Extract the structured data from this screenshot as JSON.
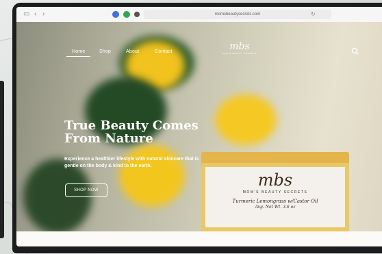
{
  "browser": {
    "url": "momsbeautysecrets.com",
    "icons": [
      "sidebar-icon",
      "back-icon",
      "forward-icon",
      "shield-icon",
      "extension-icon",
      "privacy-icon",
      "reload-icon"
    ]
  },
  "nav": {
    "items": [
      {
        "label": "Home",
        "active": true
      },
      {
        "label": "Shop",
        "active": false
      },
      {
        "label": "About",
        "active": false
      },
      {
        "label": "Contact",
        "active": false
      }
    ],
    "logo": {
      "mark": "mbs",
      "sub": "MOM'S BEAUTY SECRETS"
    }
  },
  "hero": {
    "headline": "True Beauty Comes From Nature",
    "tagline": "Experience a healthier lifestyle with natural skincare that is gentle on the body & kind to the earth.",
    "cta": "SHOP NOW"
  },
  "product": {
    "mark": "mbs",
    "brand": "MOM'S BEAUTY SECRETS",
    "name": "Turmeric Lemongrass w/Castor Oil",
    "weight": "Avg. Net Wt. 3.6 oz"
  },
  "colors": {
    "accent": "#e4b54a",
    "text": "#ffffff"
  }
}
